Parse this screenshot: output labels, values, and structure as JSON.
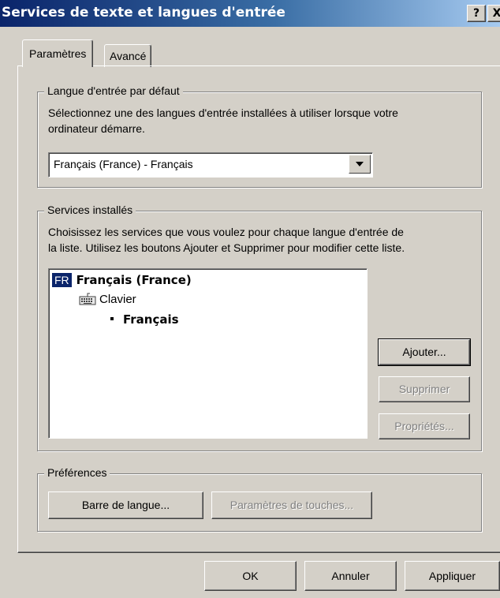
{
  "window": {
    "title": "Services de texte et langues d'entrée",
    "help_label": "?",
    "close_label": "X"
  },
  "tabs": [
    {
      "label": "Paramètres",
      "active": true
    },
    {
      "label": "Avancé",
      "active": false
    }
  ],
  "default_language": {
    "group_title": "Langue d'entrée par défaut",
    "description_line1": "Sélectionnez une des langues d'entrée installées à utiliser lorsque votre",
    "description_line2": "ordinateur démarre.",
    "selected": "Français (France) - Français"
  },
  "installed_services": {
    "group_title": "Services installés",
    "description_line1": "Choisissez les services que vous voulez pour chaque langue d'entrée de",
    "description_line2": "la liste. Utilisez les boutons Ajouter et Supprimer pour modifier cette liste.",
    "tree": {
      "language_code": "FR",
      "language_name": "Français (France)",
      "category": "Clavier",
      "service": "Français"
    },
    "buttons": {
      "add": "Ajouter...",
      "remove": "Supprimer",
      "properties": "Propriétés..."
    }
  },
  "preferences": {
    "group_title": "Préférences",
    "language_bar": "Barre de langue...",
    "key_settings": "Paramètres de touches..."
  },
  "footer": {
    "ok": "OK",
    "cancel": "Annuler",
    "apply": "Appliquer"
  },
  "colors": {
    "title_gradient_start": "#0a246a",
    "dialog_face": "#d4d0c8",
    "selection": "#0a246a"
  }
}
